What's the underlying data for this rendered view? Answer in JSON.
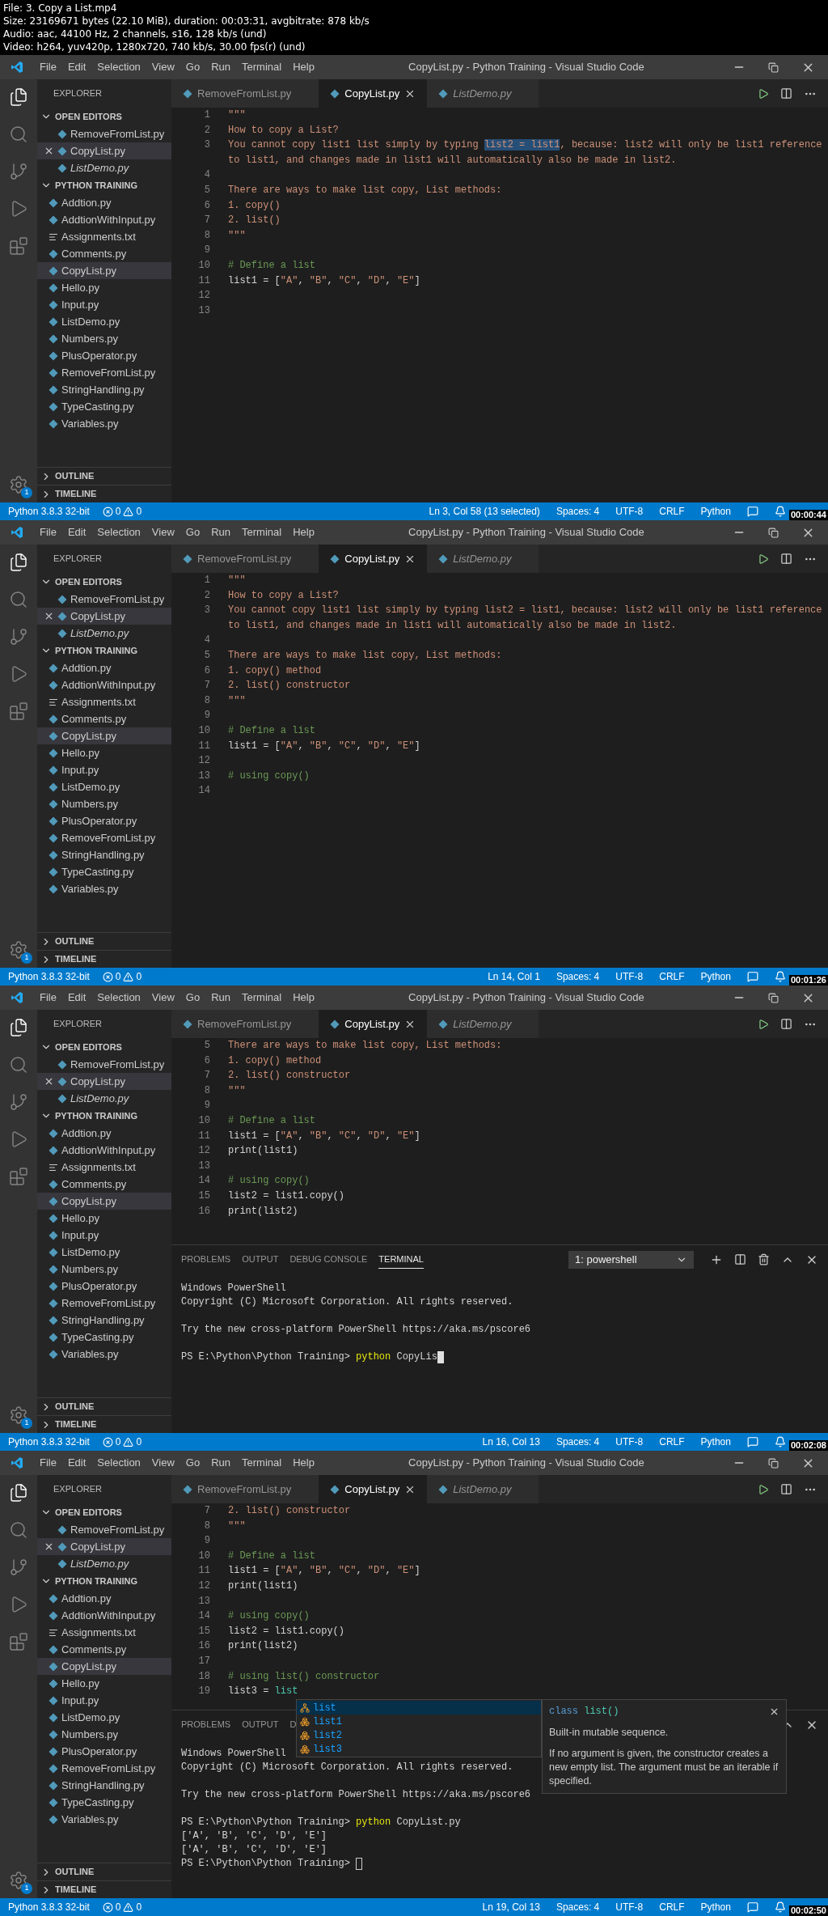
{
  "video_info": [
    "File: 3. Copy a List.mp4",
    "Size: 23169671 bytes (22.10 MiB), duration: 00:03:31, avgbitrate: 878 kb/s",
    "Audio: aac, 44100 Hz, 2 channels, s16, 128 kb/s (und)",
    "Video: h264, yuv420p, 1280x720, 740 kb/s, 30.00 fps(r) (und)"
  ],
  "frames": [
    {
      "title_bar": {
        "menu": [
          "File",
          "Edit",
          "Selection",
          "View",
          "Go",
          "Run",
          "Terminal",
          "Help"
        ],
        "title": "CopyList.py - Python Training - Visual Studio Code"
      },
      "activity_bar": {
        "badge": "1"
      },
      "sidebar": {
        "header": "EXPLORER",
        "sections": [
          {
            "title": "OPEN EDITORS",
            "expanded": true,
            "open_editors": true,
            "items": [
              {
                "label": "RemoveFromList.py",
                "kind": "py",
                "selected": false,
                "preview": false
              },
              {
                "label": "CopyList.py",
                "kind": "py",
                "selected": true,
                "preview": false
              },
              {
                "label": "ListDemo.py",
                "kind": "py",
                "selected": false,
                "preview": true
              }
            ]
          },
          {
            "title": "PYTHON TRAINING",
            "expanded": true,
            "open_editors": false,
            "items": [
              {
                "label": "Addtion.py",
                "kind": "py",
                "selected": false
              },
              {
                "label": "AddtionWithInput.py",
                "kind": "py",
                "selected": false
              },
              {
                "label": "Assignments.txt",
                "kind": "txt",
                "selected": false
              },
              {
                "label": "Comments.py",
                "kind": "py",
                "selected": false
              },
              {
                "label": "CopyList.py",
                "kind": "py",
                "selected": true
              },
              {
                "label": "Hello.py",
                "kind": "py",
                "selected": false
              },
              {
                "label": "Input.py",
                "kind": "py",
                "selected": false
              },
              {
                "label": "ListDemo.py",
                "kind": "py",
                "selected": false
              },
              {
                "label": "Numbers.py",
                "kind": "py",
                "selected": false
              },
              {
                "label": "PlusOperator.py",
                "kind": "py",
                "selected": false
              },
              {
                "label": "RemoveFromList.py",
                "kind": "py",
                "selected": false
              },
              {
                "label": "StringHandling.py",
                "kind": "py",
                "selected": false
              },
              {
                "label": "TypeCasting.py",
                "kind": "py",
                "selected": false
              },
              {
                "label": "Variables.py",
                "kind": "py",
                "selected": false
              }
            ]
          }
        ],
        "bottom": [
          {
            "title": "OUTLINE",
            "expanded": false
          },
          {
            "title": "TIMELINE",
            "expanded": false
          }
        ]
      },
      "tabs": [
        {
          "label": "RemoveFromList.py",
          "selected": false,
          "preview": false
        },
        {
          "label": "CopyList.py",
          "selected": true,
          "preview": false
        },
        {
          "label": "ListDemo.py",
          "selected": false,
          "preview": true
        }
      ],
      "code": [
        {
          "n": "1",
          "tokens": [
            {
              "text": "\"\"\"",
              "kind": "str"
            }
          ]
        },
        {
          "n": "2",
          "tokens": [
            {
              "text": "How to copy a List?",
              "kind": "str"
            }
          ]
        },
        {
          "n": "3",
          "tokens": [
            {
              "text": "You cannot copy list1 list simply by typing ",
              "kind": "str"
            },
            {
              "text": "list2 = list1",
              "kind": "sel"
            },
            {
              "text": ", because: list2 will only be list1 reference",
              "kind": "str"
            }
          ]
        },
        {
          "tokens": [
            {
              "text": "to list1, and changes made in list1 will automatically also be made in list2.",
              "kind": "str"
            }
          ]
        },
        {
          "n": "4"
        },
        {
          "n": "5",
          "tokens": [
            {
              "text": "There are ways to make list copy, List methods:",
              "kind": "str"
            }
          ]
        },
        {
          "n": "6",
          "tokens": [
            {
              "text": "1. copy()",
              "kind": "str"
            }
          ]
        },
        {
          "n": "7",
          "tokens": [
            {
              "text": "2. list()",
              "kind": "str"
            }
          ]
        },
        {
          "n": "8",
          "tokens": [
            {
              "text": "\"\"\"",
              "kind": "str"
            }
          ]
        },
        {
          "n": "9"
        },
        {
          "n": "10",
          "tokens": [
            {
              "text": "# Define a list",
              "kind": "comment"
            }
          ]
        },
        {
          "n": "11",
          "tokens": [
            {
              "text": "list1 = [",
              "kind": "plain"
            },
            {
              "text": "\"A\"",
              "kind": "str"
            },
            {
              "text": ", ",
              "kind": "plain"
            },
            {
              "text": "\"B\"",
              "kind": "str"
            },
            {
              "text": ", ",
              "kind": "plain"
            },
            {
              "text": "\"C\"",
              "kind": "str"
            },
            {
              "text": ", ",
              "kind": "plain"
            },
            {
              "text": "\"D\"",
              "kind": "str"
            },
            {
              "text": ", ",
              "kind": "plain"
            },
            {
              "text": "\"E\"",
              "kind": "str"
            },
            {
              "text": "]",
              "kind": "plain"
            }
          ]
        },
        {
          "n": "12"
        },
        {
          "n": "13"
        }
      ],
      "status_bar": {
        "interpreter": "Python 3.8.3 32-bit",
        "errors": "0",
        "warnings": "0",
        "position": "Ln 3, Col 58 (13 selected)",
        "indent": "Spaces: 4",
        "encoding": "UTF-8",
        "eol": "CRLF",
        "language": "Python"
      },
      "timestamp": "00:00:44"
    },
    {
      "title_bar": {
        "menu": [
          "File",
          "Edit",
          "Selection",
          "View",
          "Go",
          "Run",
          "Terminal",
          "Help"
        ],
        "title": "CopyList.py - Python Training - Visual Studio Code"
      },
      "activity_bar": {
        "badge": "1"
      },
      "sidebar": {
        "header": "EXPLORER",
        "sections": [
          {
            "title": "OPEN EDITORS",
            "expanded": true,
            "open_editors": true,
            "items": [
              {
                "label": "RemoveFromList.py",
                "kind": "py",
                "selected": false,
                "preview": false
              },
              {
                "label": "CopyList.py",
                "kind": "py",
                "selected": true,
                "preview": false
              },
              {
                "label": "ListDemo.py",
                "kind": "py",
                "selected": false,
                "preview": true
              }
            ]
          },
          {
            "title": "PYTHON TRAINING",
            "expanded": true,
            "open_editors": false,
            "items": [
              {
                "label": "Addtion.py",
                "kind": "py",
                "selected": false
              },
              {
                "label": "AddtionWithInput.py",
                "kind": "py",
                "selected": false
              },
              {
                "label": "Assignments.txt",
                "kind": "txt",
                "selected": false
              },
              {
                "label": "Comments.py",
                "kind": "py",
                "selected": false
              },
              {
                "label": "CopyList.py",
                "kind": "py",
                "selected": true
              },
              {
                "label": "Hello.py",
                "kind": "py",
                "selected": false
              },
              {
                "label": "Input.py",
                "kind": "py",
                "selected": false
              },
              {
                "label": "ListDemo.py",
                "kind": "py",
                "selected": false
              },
              {
                "label": "Numbers.py",
                "kind": "py",
                "selected": false
              },
              {
                "label": "PlusOperator.py",
                "kind": "py",
                "selected": false
              },
              {
                "label": "RemoveFromList.py",
                "kind": "py",
                "selected": false
              },
              {
                "label": "StringHandling.py",
                "kind": "py",
                "selected": false
              },
              {
                "label": "TypeCasting.py",
                "kind": "py",
                "selected": false
              },
              {
                "label": "Variables.py",
                "kind": "py",
                "selected": false
              }
            ]
          }
        ],
        "bottom": [
          {
            "title": "OUTLINE",
            "expanded": false
          },
          {
            "title": "TIMELINE",
            "expanded": false
          }
        ]
      },
      "tabs": [
        {
          "label": "RemoveFromList.py",
          "selected": false,
          "preview": false
        },
        {
          "label": "CopyList.py",
          "selected": true,
          "preview": false
        },
        {
          "label": "ListDemo.py",
          "selected": false,
          "preview": true
        }
      ],
      "code": [
        {
          "n": "1",
          "tokens": [
            {
              "text": "\"\"\"",
              "kind": "str"
            }
          ]
        },
        {
          "n": "2",
          "tokens": [
            {
              "text": "How to copy a List?",
              "kind": "str"
            }
          ]
        },
        {
          "n": "3",
          "tokens": [
            {
              "text": "You cannot copy list1 list simply by typing list2 = list1, because: list2 will only be list1 reference",
              "kind": "str"
            }
          ]
        },
        {
          "tokens": [
            {
              "text": "to list1, and changes made in list1 will automatically also be made in list2.",
              "kind": "str"
            }
          ]
        },
        {
          "n": "4"
        },
        {
          "n": "5",
          "tokens": [
            {
              "text": "There are ways to make list copy, List methods:",
              "kind": "str"
            }
          ]
        },
        {
          "n": "6",
          "tokens": [
            {
              "text": "1. copy() method",
              "kind": "str"
            }
          ]
        },
        {
          "n": "7",
          "tokens": [
            {
              "text": "2. list() constructor",
              "kind": "str"
            }
          ]
        },
        {
          "n": "8",
          "tokens": [
            {
              "text": "\"\"\"",
              "kind": "str"
            }
          ]
        },
        {
          "n": "9"
        },
        {
          "n": "10",
          "tokens": [
            {
              "text": "# Define a list",
              "kind": "comment"
            }
          ]
        },
        {
          "n": "11",
          "tokens": [
            {
              "text": "list1 = [",
              "kind": "plain"
            },
            {
              "text": "\"A\"",
              "kind": "str"
            },
            {
              "text": ", ",
              "kind": "plain"
            },
            {
              "text": "\"B\"",
              "kind": "str"
            },
            {
              "text": ", ",
              "kind": "plain"
            },
            {
              "text": "\"C\"",
              "kind": "str"
            },
            {
              "text": ", ",
              "kind": "plain"
            },
            {
              "text": "\"D\"",
              "kind": "str"
            },
            {
              "text": ", ",
              "kind": "plain"
            },
            {
              "text": "\"E\"",
              "kind": "str"
            },
            {
              "text": "]",
              "kind": "plain"
            }
          ]
        },
        {
          "n": "12"
        },
        {
          "n": "13",
          "tokens": [
            {
              "text": "# using copy()",
              "kind": "comment"
            }
          ]
        },
        {
          "n": "14"
        }
      ],
      "status_bar": {
        "interpreter": "Python 3.8.3 32-bit",
        "errors": "0",
        "warnings": "0",
        "position": "Ln 14, Col 1",
        "indent": "Spaces: 4",
        "encoding": "UTF-8",
        "eol": "CRLF",
        "language": "Python"
      },
      "timestamp": "00:01:26"
    },
    {
      "title_bar": {
        "menu": [
          "File",
          "Edit",
          "Selection",
          "View",
          "Go",
          "Run",
          "Terminal",
          "Help"
        ],
        "title": "CopyList.py - Python Training - Visual Studio Code"
      },
      "activity_bar": {
        "badge": "1"
      },
      "sidebar": {
        "header": "EXPLORER",
        "sections": [
          {
            "title": "OPEN EDITORS",
            "expanded": true,
            "open_editors": true,
            "items": [
              {
                "label": "RemoveFromList.py",
                "kind": "py",
                "selected": false,
                "preview": false
              },
              {
                "label": "CopyList.py",
                "kind": "py",
                "selected": true,
                "preview": false
              },
              {
                "label": "ListDemo.py",
                "kind": "py",
                "selected": false,
                "preview": true
              }
            ]
          },
          {
            "title": "PYTHON TRAINING",
            "expanded": true,
            "open_editors": false,
            "items": [
              {
                "label": "Addtion.py",
                "kind": "py",
                "selected": false
              },
              {
                "label": "AddtionWithInput.py",
                "kind": "py",
                "selected": false
              },
              {
                "label": "Assignments.txt",
                "kind": "txt",
                "selected": false
              },
              {
                "label": "Comments.py",
                "kind": "py",
                "selected": false
              },
              {
                "label": "CopyList.py",
                "kind": "py",
                "selected": true
              },
              {
                "label": "Hello.py",
                "kind": "py",
                "selected": false
              },
              {
                "label": "Input.py",
                "kind": "py",
                "selected": false
              },
              {
                "label": "ListDemo.py",
                "kind": "py",
                "selected": false
              },
              {
                "label": "Numbers.py",
                "kind": "py",
                "selected": false
              },
              {
                "label": "PlusOperator.py",
                "kind": "py",
                "selected": false
              },
              {
                "label": "RemoveFromList.py",
                "kind": "py",
                "selected": false
              },
              {
                "label": "StringHandling.py",
                "kind": "py",
                "selected": false
              },
              {
                "label": "TypeCasting.py",
                "kind": "py",
                "selected": false
              },
              {
                "label": "Variables.py",
                "kind": "py",
                "selected": false
              }
            ]
          }
        ],
        "bottom": [
          {
            "title": "OUTLINE",
            "expanded": false
          },
          {
            "title": "TIMELINE",
            "expanded": false
          }
        ]
      },
      "tabs": [
        {
          "label": "RemoveFromList.py",
          "selected": false,
          "preview": false
        },
        {
          "label": "CopyList.py",
          "selected": true,
          "preview": false
        },
        {
          "label": "ListDemo.py",
          "selected": false,
          "preview": true
        }
      ],
      "code": [
        {
          "n": "5",
          "tokens": [
            {
              "text": "There are ways to make list copy, List methods:",
              "kind": "str"
            }
          ]
        },
        {
          "n": "6",
          "tokens": [
            {
              "text": "1. copy() method",
              "kind": "str"
            }
          ]
        },
        {
          "n": "7",
          "tokens": [
            {
              "text": "2. list() constructor",
              "kind": "str"
            }
          ]
        },
        {
          "n": "8",
          "tokens": [
            {
              "text": "\"\"\"",
              "kind": "str"
            }
          ]
        },
        {
          "n": "9"
        },
        {
          "n": "10",
          "tokens": [
            {
              "text": "# Define a list",
              "kind": "comment"
            }
          ]
        },
        {
          "n": "11",
          "tokens": [
            {
              "text": "list1 = [",
              "kind": "plain"
            },
            {
              "text": "\"A\"",
              "kind": "str"
            },
            {
              "text": ", ",
              "kind": "plain"
            },
            {
              "text": "\"B\"",
              "kind": "str"
            },
            {
              "text": ", ",
              "kind": "plain"
            },
            {
              "text": "\"C\"",
              "kind": "str"
            },
            {
              "text": ", ",
              "kind": "plain"
            },
            {
              "text": "\"D\"",
              "kind": "str"
            },
            {
              "text": ", ",
              "kind": "plain"
            },
            {
              "text": "\"E\"",
              "kind": "str"
            },
            {
              "text": "]",
              "kind": "plain"
            }
          ]
        },
        {
          "n": "12",
          "tokens": [
            {
              "text": "print(list1)",
              "kind": "plain"
            }
          ]
        },
        {
          "n": "13"
        },
        {
          "n": "14",
          "tokens": [
            {
              "text": "# using copy()",
              "kind": "comment"
            }
          ]
        },
        {
          "n": "15",
          "tokens": [
            {
              "text": "list2 = list1.copy()",
              "kind": "plain"
            }
          ]
        },
        {
          "n": "16",
          "tokens": [
            {
              "text": "print(list2)",
              "kind": "plain"
            }
          ]
        }
      ],
      "panel": {
        "tabs": [
          {
            "label": "PROBLEMS",
            "selected": false
          },
          {
            "label": "OUTPUT",
            "selected": false
          },
          {
            "label": "DEBUG CONSOLE",
            "selected": false
          },
          {
            "label": "TERMINAL",
            "selected": true
          }
        ],
        "dropdown": "1: powershell",
        "actions": [
          {
            "kind": "new"
          },
          {
            "kind": "split"
          },
          {
            "kind": "kill"
          },
          {
            "kind": "maximize"
          },
          {
            "kind": "close"
          }
        ],
        "lines": [
          {
            "tokens": [
              {
                "text": "Windows PowerShell",
                "kind": "plain"
              }
            ]
          },
          {
            "tokens": [
              {
                "text": "Copyright (C) Microsoft Corporation. All rights reserved.",
                "kind": "plain"
              }
            ]
          },
          {
            "gap_before": true,
            "tokens": [
              {
                "text": "Try the new cross-platform PowerShell https://aka.ms/pscore6",
                "kind": "plain"
              }
            ]
          },
          {
            "gap_before": true,
            "tokens": [
              {
                "text": "PS E:\\Python\\Python Training> ",
                "kind": "plain"
              },
              {
                "text": "python",
                "kind": "cmd"
              },
              {
                "text": " CopyLis",
                "kind": "plain"
              }
            ],
            "cursor": {
              "kind": "block"
            }
          }
        ]
      },
      "status_bar": {
        "interpreter": "Python 3.8.3 32-bit",
        "errors": "0",
        "warnings": "0",
        "position": "Ln 16, Col 13",
        "indent": "Spaces: 4",
        "encoding": "UTF-8",
        "eol": "CRLF",
        "language": "Python"
      },
      "timestamp": "00:02:08"
    },
    {
      "title_bar": {
        "menu": [
          "File",
          "Edit",
          "Selection",
          "View",
          "Go",
          "Run",
          "Terminal",
          "Help"
        ],
        "title": "CopyList.py - Python Training - Visual Studio Code"
      },
      "activity_bar": {
        "badge": "1"
      },
      "sidebar": {
        "header": "EXPLORER",
        "sections": [
          {
            "title": "OPEN EDITORS",
            "expanded": true,
            "open_editors": true,
            "items": [
              {
                "label": "RemoveFromList.py",
                "kind": "py",
                "selected": false,
                "preview": false
              },
              {
                "label": "CopyList.py",
                "kind": "py",
                "selected": true,
                "preview": false
              },
              {
                "label": "ListDemo.py",
                "kind": "py",
                "selected": false,
                "preview": true
              }
            ]
          },
          {
            "title": "PYTHON TRAINING",
            "expanded": true,
            "open_editors": false,
            "items": [
              {
                "label": "Addtion.py",
                "kind": "py",
                "selected": false
              },
              {
                "label": "AddtionWithInput.py",
                "kind": "py",
                "selected": false
              },
              {
                "label": "Assignments.txt",
                "kind": "txt",
                "selected": false
              },
              {
                "label": "Comments.py",
                "kind": "py",
                "selected": false
              },
              {
                "label": "CopyList.py",
                "kind": "py",
                "selected": true
              },
              {
                "label": "Hello.py",
                "kind": "py",
                "selected": false
              },
              {
                "label": "Input.py",
                "kind": "py",
                "selected": false
              },
              {
                "label": "ListDemo.py",
                "kind": "py",
                "selected": false
              },
              {
                "label": "Numbers.py",
                "kind": "py",
                "selected": false
              },
              {
                "label": "PlusOperator.py",
                "kind": "py",
                "selected": false
              },
              {
                "label": "RemoveFromList.py",
                "kind": "py",
                "selected": false
              },
              {
                "label": "StringHandling.py",
                "kind": "py",
                "selected": false
              },
              {
                "label": "TypeCasting.py",
                "kind": "py",
                "selected": false
              },
              {
                "label": "Variables.py",
                "kind": "py",
                "selected": false
              }
            ]
          }
        ],
        "bottom": [
          {
            "title": "OUTLINE",
            "expanded": false
          },
          {
            "title": "TIMELINE",
            "expanded": false
          }
        ]
      },
      "tabs": [
        {
          "label": "RemoveFromList.py",
          "selected": false,
          "preview": false
        },
        {
          "label": "CopyList.py",
          "selected": true,
          "preview": false
        },
        {
          "label": "ListDemo.py",
          "selected": false,
          "preview": true
        }
      ],
      "code": [
        {
          "n": "7",
          "tokens": [
            {
              "text": "2. list() constructor",
              "kind": "str"
            }
          ]
        },
        {
          "n": "8",
          "tokens": [
            {
              "text": "\"\"\"",
              "kind": "str"
            }
          ]
        },
        {
          "n": "9"
        },
        {
          "n": "10",
          "tokens": [
            {
              "text": "# Define a list",
              "kind": "comment"
            }
          ]
        },
        {
          "n": "11",
          "tokens": [
            {
              "text": "list1 = [",
              "kind": "plain"
            },
            {
              "text": "\"A\"",
              "kind": "str"
            },
            {
              "text": ", ",
              "kind": "plain"
            },
            {
              "text": "\"B\"",
              "kind": "str"
            },
            {
              "text": ", ",
              "kind": "plain"
            },
            {
              "text": "\"C\"",
              "kind": "str"
            },
            {
              "text": ", ",
              "kind": "plain"
            },
            {
              "text": "\"D\"",
              "kind": "str"
            },
            {
              "text": ", ",
              "kind": "plain"
            },
            {
              "text": "\"E\"",
              "kind": "str"
            },
            {
              "text": "]",
              "kind": "plain"
            }
          ]
        },
        {
          "n": "12",
          "tokens": [
            {
              "text": "print(list1)",
              "kind": "plain"
            }
          ]
        },
        {
          "n": "13"
        },
        {
          "n": "14",
          "tokens": [
            {
              "text": "# using copy()",
              "kind": "comment"
            }
          ]
        },
        {
          "n": "15",
          "tokens": [
            {
              "text": "list2 = list1.copy()",
              "kind": "plain"
            }
          ]
        },
        {
          "n": "16",
          "tokens": [
            {
              "text": "print(list2)",
              "kind": "plain"
            }
          ]
        },
        {
          "n": "17"
        },
        {
          "n": "18",
          "tokens": [
            {
              "text": "# using list() constructor",
              "kind": "comment"
            }
          ]
        },
        {
          "n": "19",
          "tokens": [
            {
              "text": "list3 = ",
              "kind": "plain"
            },
            {
              "text": "list",
              "kind": "cls"
            }
          ]
        }
      ],
      "panel": {
        "tabs": [
          {
            "label": "PROBLEMS",
            "selected": false
          },
          {
            "label": "OUTPUT",
            "selected": false
          },
          {
            "label": "D",
            "selected": false
          }
        ],
        "actions": [
          {
            "kind": "maximize"
          },
          {
            "kind": "close"
          }
        ],
        "lines": [
          {
            "tokens": [
              {
                "text": "Windows PowerShell",
                "kind": "plain"
              }
            ]
          },
          {
            "tokens": [
              {
                "text": "Copyright (C) Microsoft Corporation. All rights reserved.",
                "kind": "plain"
              }
            ]
          },
          {
            "gap_before": true,
            "tokens": [
              {
                "text": "Try the new cross-platform PowerShell https://aka.ms/pscore6",
                "kind": "plain"
              }
            ]
          },
          {
            "gap_before": true,
            "tokens": [
              {
                "text": "PS E:\\Python\\Python Training> ",
                "kind": "plain"
              },
              {
                "text": "python",
                "kind": "cmd"
              },
              {
                "text": " CopyList.py",
                "kind": "plain"
              }
            ]
          },
          {
            "tokens": [
              {
                "text": "['A', 'B', 'C', 'D', 'E']",
                "kind": "plain"
              }
            ]
          },
          {
            "tokens": [
              {
                "text": "['A', 'B', 'C', 'D', 'E']",
                "kind": "plain"
              }
            ]
          },
          {
            "tokens": [
              {
                "text": "PS E:\\Python\\Python Training> ",
                "kind": "plain"
              }
            ],
            "cursor": {
              "kind": "outline"
            }
          }
        ]
      },
      "suggest": {
        "items": [
          {
            "label": "list",
            "kind": "class",
            "selected": true
          },
          {
            "label": "list1",
            "kind": "variable",
            "selected": false
          },
          {
            "label": "list2",
            "kind": "variable",
            "selected": false
          },
          {
            "label": "list3",
            "kind": "variable",
            "selected": false
          }
        ],
        "signature": [
          {
            "text": "class",
            "kind": "keyword"
          },
          {
            "text": "list()",
            "kind": "cls"
          }
        ],
        "summary": "Built-in mutable sequence.",
        "description": "If no argument is given, the constructor creates a new empty list. The argument must be an iterable if specified."
      },
      "status_bar": {
        "interpreter": "Python 3.8.3 32-bit",
        "errors": "0",
        "warnings": "0",
        "position": "Ln 19, Col 13",
        "indent": "Spaces: 4",
        "encoding": "UTF-8",
        "eol": "CRLF",
        "language": "Python"
      },
      "timestamp": "00:02:50"
    }
  ]
}
